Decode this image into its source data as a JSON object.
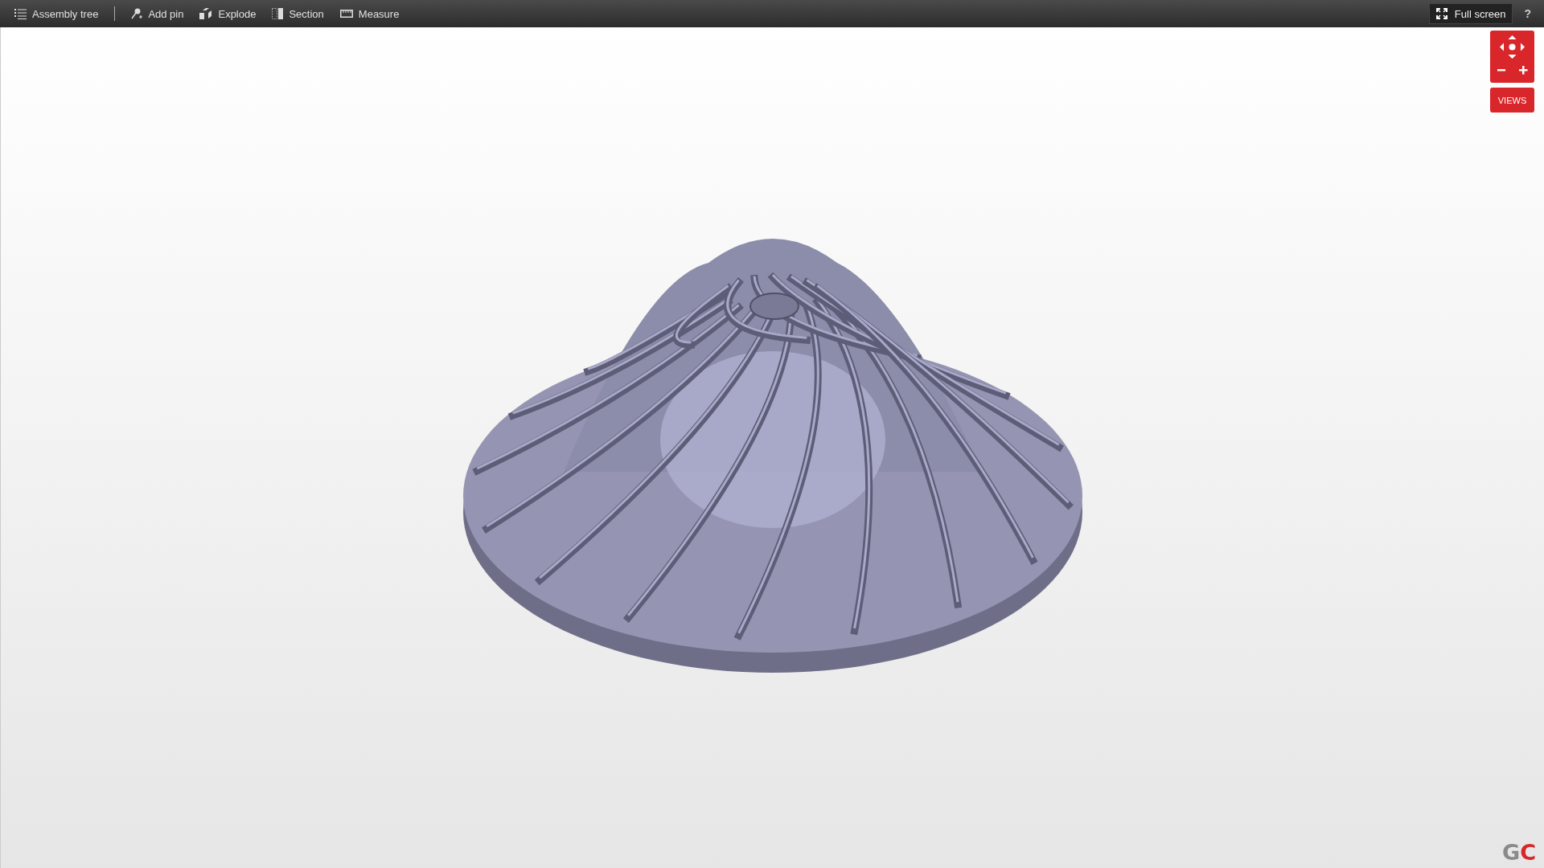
{
  "toolbar": {
    "tools": [
      {
        "kind": "tree",
        "label": "Assembly tree"
      },
      {
        "kind": "pin",
        "label": "Add pin"
      },
      {
        "kind": "explode",
        "label": "Explode"
      },
      {
        "kind": "section",
        "label": "Section"
      },
      {
        "kind": "measure",
        "label": "Measure"
      }
    ],
    "fullscreen": {
      "label": "Full screen"
    },
    "help": "?"
  },
  "viewer": {
    "views_button": "VIEWS",
    "logo": {
      "first": "G",
      "second": "C"
    }
  }
}
